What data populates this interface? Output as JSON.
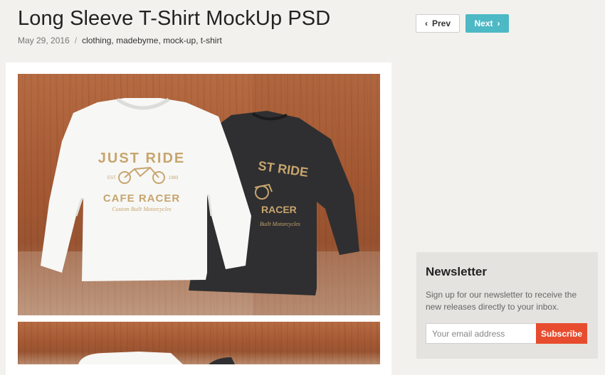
{
  "post": {
    "title": "Long Sleeve T-Shirt MockUp PSD",
    "date": "May 29, 2016",
    "separator": "/",
    "tags": "clothing, madebyme, mock-up, t-shirt"
  },
  "pagination": {
    "prev_label": "Prev",
    "next_label": "Next",
    "prev_icon": "chevron-left-icon",
    "next_icon": "chevron-right-icon",
    "next_color": "#4db9c5"
  },
  "mockup_image": {
    "print_line1": "JUST RIDE",
    "print_est": "EST.",
    "print_year": "1983",
    "print_line2": "CAFE RACER",
    "print_line3": "Custom Built Motorcycles",
    "dark_line1": "ST RIDE",
    "dark_line2": "RACER",
    "dark_line3": "Built Motorcycles",
    "print_color": "#c7a56e"
  },
  "newsletter": {
    "title": "Newsletter",
    "description": "Sign up for our newsletter to receive the new releases directly to your inbox.",
    "email_placeholder": "Your email address",
    "subscribe_label": "Subscribe",
    "button_color": "#e74c2e"
  }
}
